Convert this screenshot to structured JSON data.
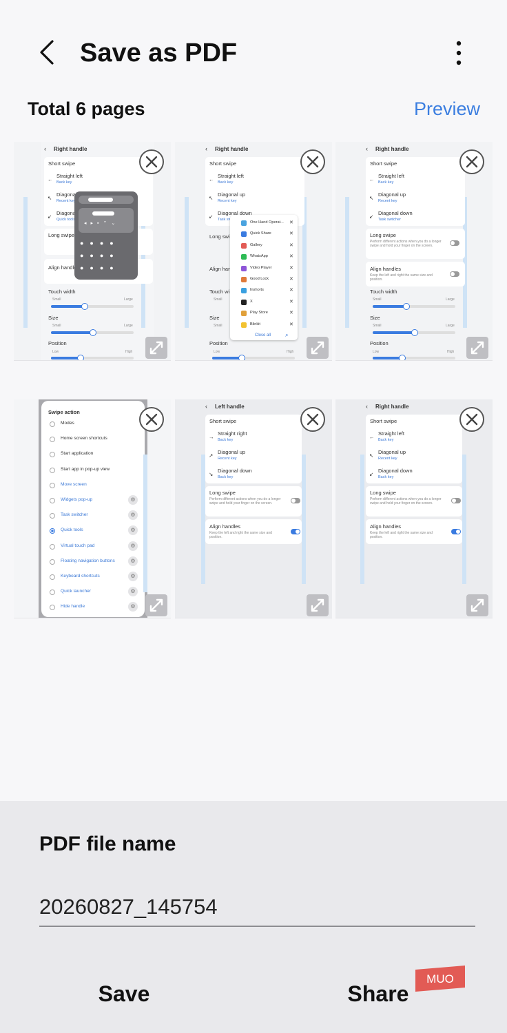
{
  "header": {
    "title": "Save as PDF",
    "back_icon": "chevron-left-icon",
    "more_icon": "more-vertical-icon"
  },
  "summary": {
    "total_pages": "Total 6 pages",
    "preview_label": "Preview"
  },
  "pages": [
    {
      "header": "Right handle",
      "section": "Short swipe",
      "items": [
        {
          "title": "Straight left",
          "sub": "Back key"
        },
        {
          "title": "Diagonal up",
          "sub": "Recent key"
        },
        {
          "title": "Diagonal down",
          "sub": "Quick tools"
        }
      ],
      "long_swipe": "Long swipe",
      "long_swipe_desc": "Perform different actions when you do a longer swipe and hold your finger on the screen.",
      "align": "Align handles",
      "align_desc": "Keep the left and right the same size and position.",
      "touch_width": "Touch width",
      "size": "Size",
      "position": "Position",
      "small": "Small",
      "large": "Large",
      "low": "Low",
      "high": "High"
    },
    {
      "header": "Right handle",
      "section": "Short swipe",
      "items": [
        {
          "title": "Straight left",
          "sub": "Back key"
        },
        {
          "title": "Diagonal up",
          "sub": "Recent key"
        },
        {
          "title": "Diagonal down",
          "sub": "Task switcher"
        }
      ],
      "popup": [
        "One Hand Operat...",
        "Quick Share",
        "Gallery",
        "WhatsApp",
        "Video Player",
        "Good Lock",
        "Inshorts",
        "X",
        "Play Store",
        "Blinkit"
      ],
      "close_all": "Close all",
      "long_swipe": "Long swi",
      "align": "Align han",
      "touch_width": "Touch wi",
      "size": "Size",
      "position": "Position",
      "small": "Small",
      "low": "Low",
      "high": "High"
    },
    {
      "header": "Right handle",
      "section": "Short swipe",
      "items": [
        {
          "title": "Straight left",
          "sub": "Back key"
        },
        {
          "title": "Diagonal up",
          "sub": "Recent key"
        },
        {
          "title": "Diagonal down",
          "sub": "Task switcher"
        }
      ],
      "long_swipe": "Long swipe",
      "long_swipe_desc": "Perform different actions when you do a longer swipe and hold your finger on the screen.",
      "align": "Align handles",
      "align_desc": "Keep the left and right the same size and position.",
      "touch_width": "Touch width",
      "size": "Size",
      "position": "Position",
      "small": "Small",
      "large": "Large",
      "low": "Low",
      "high": "High"
    },
    {
      "dialog_title": "Swipe action",
      "options": [
        "Modes",
        "Home screen shortcuts",
        "Start application",
        "Start app in pop-up view",
        "Move screen",
        "Widgets pop-up",
        "Task switcher",
        "Quick tools",
        "Virtual touch pad",
        "Floating navigation buttons",
        "Keyboard shortcuts",
        "Quick launcher",
        "Hide handle"
      ],
      "selected": "Quick tools"
    },
    {
      "header": "Left handle",
      "section": "Short swipe",
      "items": [
        {
          "title": "Straight right",
          "sub": "Back key"
        },
        {
          "title": "Diagonal up",
          "sub": "Recent key"
        },
        {
          "title": "Diagonal down",
          "sub": "Back key"
        }
      ],
      "long_swipe": "Long swipe",
      "long_swipe_desc": "Perform different actions when you do a longer swipe and hold your finger on the screen.",
      "align": "Align handles",
      "align_desc": "Keep the left and right the same size and position."
    },
    {
      "header": "Right handle",
      "section": "Short swipe",
      "items": [
        {
          "title": "Straight left",
          "sub": "Back key"
        },
        {
          "title": "Diagonal up",
          "sub": "Recent key"
        },
        {
          "title": "Diagonal down",
          "sub": "Back key"
        }
      ],
      "long_swipe": "Long swipe",
      "long_swipe_desc": "Perform different actions when you do a longer swipe and hold your finger on the screen.",
      "align": "Align handles",
      "align_desc": "Keep the left and right the same size and position."
    }
  ],
  "file": {
    "label": "PDF file name",
    "value": "20260827_145754"
  },
  "actions": {
    "save": "Save",
    "share": "Share"
  },
  "watermark": "MUO",
  "colors": {
    "accent": "#3b7ee0",
    "sheet": "#e9e9ec",
    "background": "#f7f7f9"
  }
}
